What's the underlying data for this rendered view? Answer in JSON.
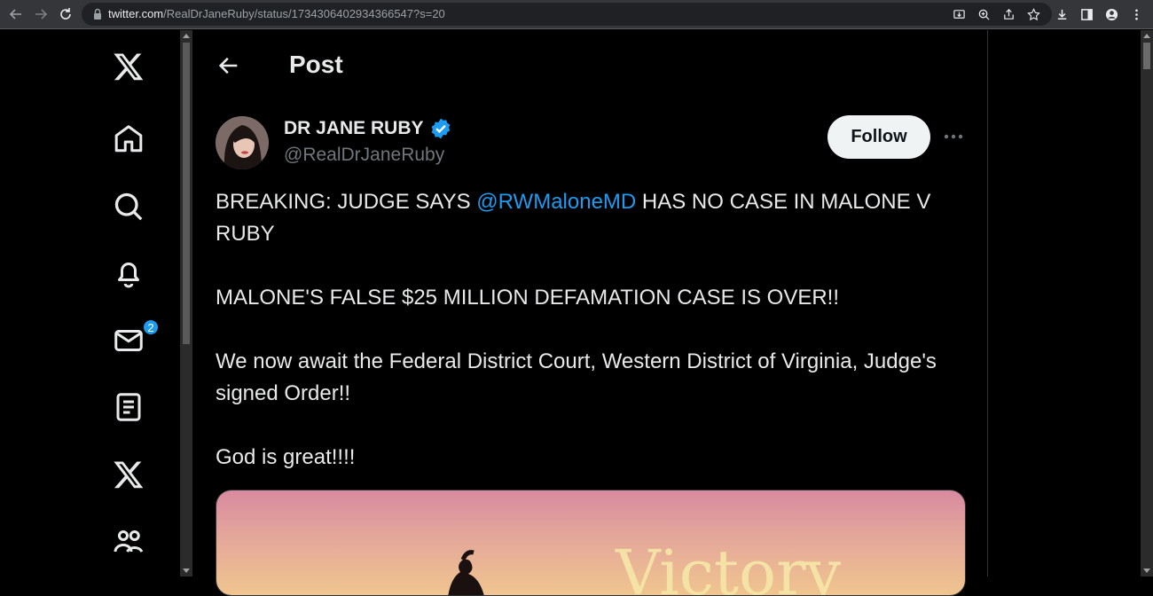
{
  "browser": {
    "url_host": "twitter.com",
    "url_path": "/RealDrJaneRuby/status/1734306402934366547?s=20"
  },
  "sidebar": {
    "items": [
      {
        "name": "x-logo",
        "icon": "x-logo-icon"
      },
      {
        "name": "home",
        "icon": "home-icon"
      },
      {
        "name": "explore",
        "icon": "search-icon"
      },
      {
        "name": "notifications",
        "icon": "bell-icon"
      },
      {
        "name": "messages",
        "icon": "mail-icon",
        "badge": "2"
      },
      {
        "name": "lists",
        "icon": "list-icon"
      },
      {
        "name": "premium",
        "icon": "x-logo-icon"
      },
      {
        "name": "communities",
        "icon": "communities-icon"
      }
    ]
  },
  "header": {
    "title": "Post"
  },
  "post": {
    "display_name": "DR JANE RUBY",
    "handle": "@RealDrJaneRuby",
    "follow_label": "Follow",
    "text": {
      "line1_prefix": "BREAKING:  JUDGE SAYS ",
      "mention": "@RWMaloneMD",
      "line1_suffix": " HAS NO CASE IN MALONE V RUBY",
      "para2": "MALONE'S FALSE $25 MILLION DEFAMATION CASE IS OVER!!",
      "para3": "We now await the Federal  District Court, Western District of Virginia, Judge's  signed Order!!",
      "para4": "God is great!!!!"
    },
    "media_text": "Victory"
  },
  "colors": {
    "accent": "#1d9bf0",
    "text": "#e7e9ea",
    "muted": "#71767b"
  }
}
